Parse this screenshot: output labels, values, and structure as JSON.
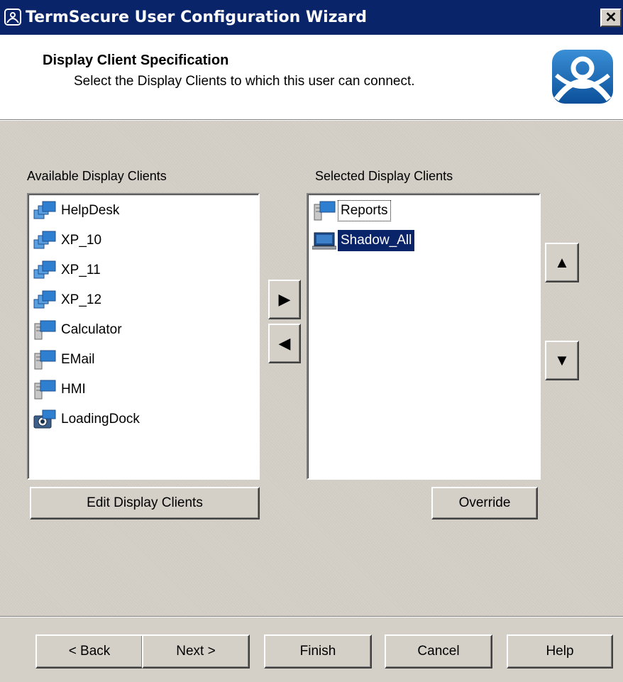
{
  "window": {
    "title": "TermSecure User Configuration Wizard",
    "close_glyph": "✕"
  },
  "header": {
    "title": "Display Client Specification",
    "subtitle": "Select the Display Clients to which this user can connect.",
    "logo_icon": "thinmanager-logo-icon"
  },
  "available": {
    "label": "Available Display Clients",
    "items": [
      {
        "label": "HelpDesk",
        "icon": "terminal-group-icon"
      },
      {
        "label": "XP_10",
        "icon": "terminal-group-icon"
      },
      {
        "label": "XP_11",
        "icon": "terminal-group-icon"
      },
      {
        "label": "XP_12",
        "icon": "terminal-group-icon"
      },
      {
        "label": "Calculator",
        "icon": "server-app-icon"
      },
      {
        "label": "EMail",
        "icon": "server-app-icon"
      },
      {
        "label": "HMI",
        "icon": "server-app-icon"
      },
      {
        "label": "LoadingDock",
        "icon": "camera-icon"
      }
    ],
    "edit_button": "Edit Display Clients"
  },
  "selected": {
    "label": "Selected Display Clients",
    "items": [
      {
        "label": "Reports",
        "icon": "server-app-icon",
        "focused": true
      },
      {
        "label": "Shadow_All",
        "icon": "shadow-monitor-icon",
        "selected": true
      }
    ],
    "override_button": "Override"
  },
  "move_buttons": {
    "add_glyph": "▶",
    "remove_glyph": "◀",
    "up_glyph": "▲",
    "down_glyph": "▼"
  },
  "footer": {
    "back": "< Back",
    "next": "Next >",
    "finish": "Finish",
    "cancel": "Cancel",
    "help": "Help"
  },
  "colors": {
    "titlebar": "#0a246a",
    "selection": "#0a246a",
    "face": "#d4d0c8"
  }
}
